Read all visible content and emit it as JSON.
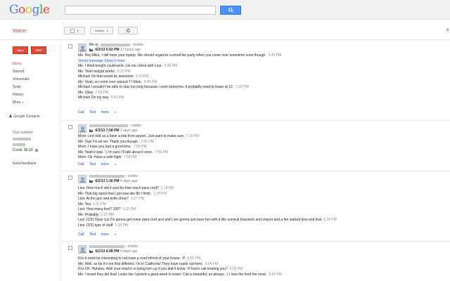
{
  "header": {
    "logo": "Google"
  },
  "product": {
    "name": "Voice"
  },
  "toolbar": {
    "actions_label": "Actions",
    "settings_partial": "S"
  },
  "sidebar": {
    "call_label": "CALL",
    "text_label": "TEXT",
    "nav": [
      "Inbox",
      "Starred",
      "Voicemails",
      "Texts",
      "History",
      "More"
    ],
    "contacts_label": "Google Contacts",
    "your_number_label": "Your number",
    "credit_label": "Credit:",
    "credit_value": "$6.10",
    "feedback_label": "Send feedback"
  },
  "conversations": [
    {
      "head_from": "Me to",
      "head_tail": " - mobile",
      "time": "6/3/13 6:52 PM",
      "ago": "17 hours ago",
      "messages": [
        {
          "text": "Me: Hey Mike, I still have your laptop. We should organize a small fan party when you come over sometime soon though.",
          "time": "3:45 PM"
        },
        {
          "text": "1more message  Show 5 more",
          "time": ""
        },
        {
          "text": "Me: I think tonight could work. Let me check with Levi.",
          "time": "5:06 PM"
        },
        {
          "text": "Me: Yeah tonight works.",
          "time": "5:22 PM"
        },
        {
          "text": "Michael          Ok that would be awesome",
          "time": "5:23 PM"
        },
        {
          "text": "Me: Yeah, so come over around 7 I think.",
          "time": "5:45 PM"
        },
        {
          "text": "Michael          I wouldn't be able to stay too long because I work tomorrow. It probably need to leave at 12.",
          "time": "7:22 PM"
        },
        {
          "text": "Me: Okay",
          "time": "7:22 PM"
        },
        {
          "text": "Michael          On my way",
          "time": "6:52 PM"
        }
      ]
    },
    {
      "head_from": "",
      "head_tail": " - mobile",
      "time": "6/3/13 7:58 PM",
      "ago": "2 days ago",
      "messages": [
        {
          "text": "Mom: Levi told us u have a ride from airport. Just want to make sure",
          "time": "7:16 PM"
        },
        {
          "text": "Me: Yup! I'm all set. Thank you though.",
          "time": "7:55 PM"
        },
        {
          "text": "Mom: I hope you had a good time.",
          "time": "7:56 PM"
        },
        {
          "text": "Me: Yeah it was. :) I'm sure I'll talk about it soon.",
          "time": "7:56 PM"
        },
        {
          "text": "Mom: Ok. Have a safe flight",
          "time": "7:58 PM"
        }
      ]
    },
    {
      "head_from": "",
      "head_tail": " - mobile",
      "time": "6/2/13 1:36 PM",
      "ago": "4 days ago",
      "messages": [
        {
          "text": "Levi: How much did it cost for how much para cord?",
          "time": "1:18 PM"
        },
        {
          "text": "Me: That big spool that I got was like $5 I think.",
          "time": "1:20 PM"
        },
        {
          "text": "Levi: At the gun and knife show?",
          "time": "1:27 PM"
        },
        {
          "text": "Me: Yea",
          "time": "1:30 PM"
        },
        {
          "text": "Levi: How many feet? 100?",
          "time": "1:31 PM"
        },
        {
          "text": "Me: Probably",
          "time": "1:31 PM"
        },
        {
          "text": "Levi: (1/2) Okay cuz I'm gonna get some para cord and           and I are gonna just have fun with it like survival bracelets and snares and a fire started bow and that",
          "time": "1:34 PM"
        },
        {
          "text": "Levi: (2/2) type of stuff",
          "time": "1:34 PM"
        }
      ]
    },
    {
      "head_from": "",
      "head_tail": " - mobile",
      "time": "6/1/13 6:08 PM",
      "ago": "4 days ago",
      "messages": [
        {
          "text": "Kris           it must be interesting to not have a road infront of your house.  :P",
          "time": "5:56 PM"
        },
        {
          "text": "Me: Well, as far it's not that different. I'm in California! They have roads out here.",
          "time": "6:04 PM"
        },
        {
          "text": "Kris           Oh. Hahaha.  Well your road in           is being torn up if you didn't know. :P how's cali treating you?",
          "time": "6:06 PM"
        },
        {
          "text": "Me: I heard they did that! Looks like I picked a good week to leave. Cali is beautiful, as always. :) I love the food the most.",
          "time": "6:10 PM"
        }
      ]
    }
  ],
  "conv_links": {
    "call": "Call",
    "text": "Text",
    "more": "more"
  }
}
